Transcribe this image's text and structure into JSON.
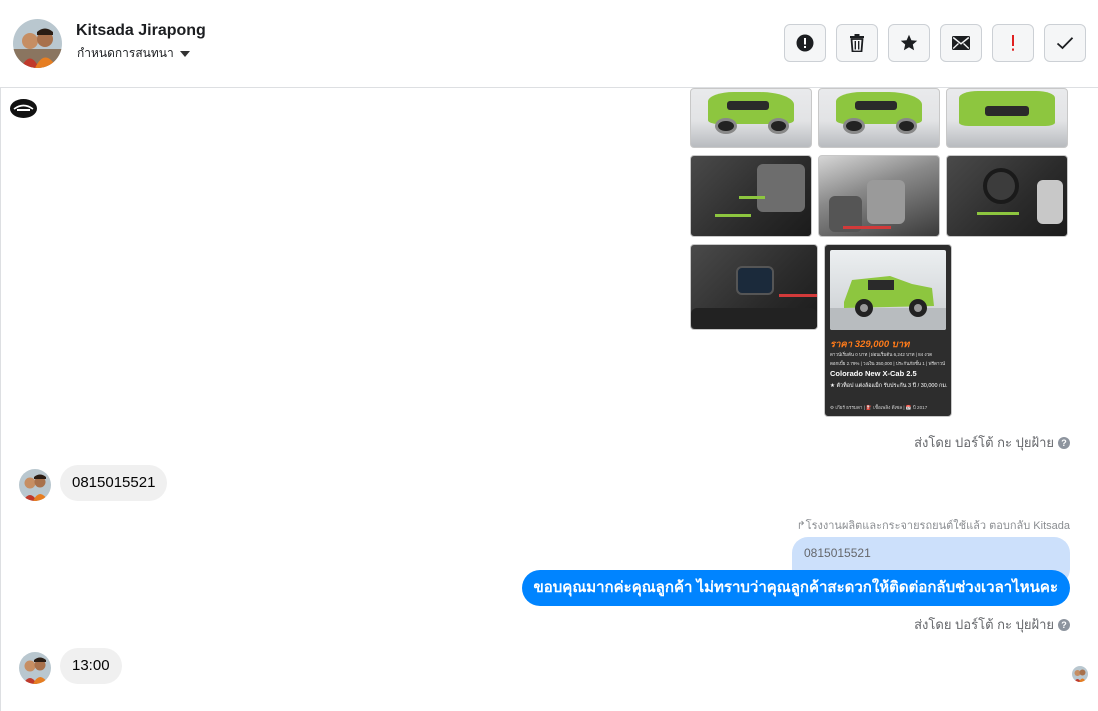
{
  "header": {
    "contact_name": "Kitsada Jirapong",
    "conversation_settings": "กำหนดการสนทนา"
  },
  "toolbar": {
    "buttons": [
      {
        "icon": "alert-circle-icon"
      },
      {
        "icon": "trash-icon"
      },
      {
        "icon": "star-icon"
      },
      {
        "icon": "envelope-icon"
      },
      {
        "icon": "exclamation-icon"
      },
      {
        "icon": "checkmark-icon"
      }
    ]
  },
  "flyer": {
    "price": "ราคา 329,000 บาท",
    "line1": "ดาวน์เริ่มต้น 0 บาท | ผ่อนเริ่มต้น 6,242 บาท | 84 งวด",
    "line2": "ดอกเบี้ย 2.79% | วงเงิน 350,000 | ประกันภัยชั้น 1 | ฟรีดาวน์",
    "model": "Colorado New X-Cab 2.5",
    "features": "★ ตัวท็อป แต่งล้อแม็ก รับประกัน 3 ปี / 30,000 กม.",
    "footer": "⚙ เกียร์ ธรรมดา  |  ⛽ เชื้อเพลิง ดีเซล  |  📅 ปี 2017"
  },
  "messages": {
    "sent_by_1": "ส่งโดย ปอร์โต้ กะ ปุยฝ้าย",
    "incoming_1": "0815015521",
    "reply_caption": "↱โรงงานผลิตและกระจายรถยนต์ใช้แล้ว ตอบกลับ Kitsada",
    "quoted_text": "0815015521",
    "outgoing_1": "ขอบคุณมากค่ะคุณลูกค้า ไม่ทราบว่าคุณลูกค้าสะดวกให้ติดต่อกลับช่วงเวลาไหนคะ",
    "sent_by_2": "ส่งโดย ปอร์โต้ กะ ปุยฝ้าย",
    "incoming_2": "13:00",
    "help_glyph": "?"
  },
  "colors": {
    "outgoing_bubble": "#0084ff",
    "incoming_bubble": "#f0f0f0",
    "quoted_bubble": "#cce0fb",
    "car_green": "#8dc63f"
  }
}
